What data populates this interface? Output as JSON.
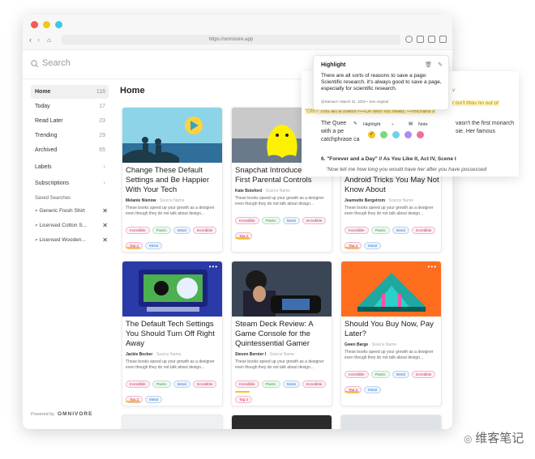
{
  "browser": {
    "url": "https://omnivore.app"
  },
  "search": {
    "placeholder": "Search"
  },
  "sidebar": {
    "items": [
      {
        "label": "Home",
        "count": "116"
      },
      {
        "label": "Today",
        "count": "17"
      },
      {
        "label": "Read Later",
        "count": "23"
      },
      {
        "label": "Trending",
        "count": "29"
      },
      {
        "label": "Archived",
        "count": "65"
      },
      {
        "label": "Labels",
        "count": "›"
      },
      {
        "label": "Subscriptions",
        "count": "›"
      }
    ],
    "saved_title": "Saved Searches",
    "saved": [
      "Generic Fresh Shirt",
      "Licensed Cotton S...",
      "Licensed Wooden..."
    ],
    "powered": "Powered by",
    "brand": "OMNIVORE"
  },
  "main": {
    "title": "Home"
  },
  "cards": [
    {
      "title": "Change These Default Settings and Be Happier With Your Tech",
      "author": "Melanie Nienow",
      "source": "· Source Name",
      "desc": "These books speed up your growth as a designer even though they do not talk about design...",
      "tags": [
        "Incredible",
        "Plastic",
        "Metal",
        "Incredible",
        "Tag 2",
        "Metal"
      ]
    },
    {
      "title": "Snapchat Introduces Its First Parental Controls",
      "author": "Kate Botsford",
      "source": "· Source Name",
      "desc": "These books speed up your growth as a designer even though they do not talk about design...",
      "tags": [
        "Incredible",
        "Plastic",
        "Metal",
        "Incredible",
        "Tag 2"
      ]
    },
    {
      "title": "4 Helpful iPhone and Android Tricks You May Not Know About",
      "author": "Jeannette Bergstrom",
      "source": "· Source Name",
      "desc": "These books speed up your growth as a designer even though they do not talk about design...",
      "tags": [
        "Incredible",
        "Plastic",
        "Metal",
        "Incredible",
        "Tag 2",
        "Metal"
      ]
    },
    {
      "title": "The Default Tech Settings You Should Turn Off Right Away",
      "author": "Jackie Becker",
      "source": "· Source Name",
      "desc": "These books speed up your growth as a designer even though they do not talk about design...",
      "tags": [
        "Incredible",
        "Plastic",
        "Metal",
        "Incredible",
        "Tag 2",
        "Metal"
      ]
    },
    {
      "title": "Steam Deck Review: A Game Console for the Quintessential Gamer",
      "author": "Steven Bernier I",
      "source": "· Source Name",
      "desc": "These books speed up your growth as a designer even though they do not talk about design...",
      "tags": [
        "Incredible",
        "Plastic",
        "Metal",
        "Incredible",
        "Tag 2"
      ]
    },
    {
      "title": "Should You Buy Now, Pay Later?",
      "author": "Gwen Barge",
      "source": "· Source Name",
      "desc": "These books speed up your growth as a designer even though they do not talk about design...",
      "tags": [
        "Incredible",
        "Plastic",
        "Metal",
        "Incredible",
        "Tag 2",
        "Metal"
      ]
    }
  ],
  "highlight_popup": {
    "heading": "Highlight",
    "quote": "There are all sorts of reasons to save a page: Scientific research. it's always good to save a page, especially for scientific research.",
    "meta": "@Samuel • March 31, 2022 • See original"
  },
  "reader": {
    "lines": [
      "The Quee",
      "with a pe",
      "catchphrase ca"
    ],
    "right_lines": [
      "vasn't the first monarch",
      "sie. Her famous"
    ],
    "hl1": "r isn't thou no out of",
    "hl2": "\"Oh!? This art a traitor?—Off with his head.\"—Richard II",
    "heading_tail": "v",
    "highlight_label": "Highlight",
    "note_label": "Note",
    "section": "6. \"Forever and a Day\" // As You Like It, Act IV, Scene I",
    "quote": "\"Now tell me how long you would have her after you have possessed"
  },
  "colors": {
    "yellow": "#f5c518",
    "green": "#7ed67e",
    "cyan": "#6fd3e8",
    "purple": "#b18ae8",
    "pink": "#f06f9a"
  },
  "watermark": "维客笔记"
}
